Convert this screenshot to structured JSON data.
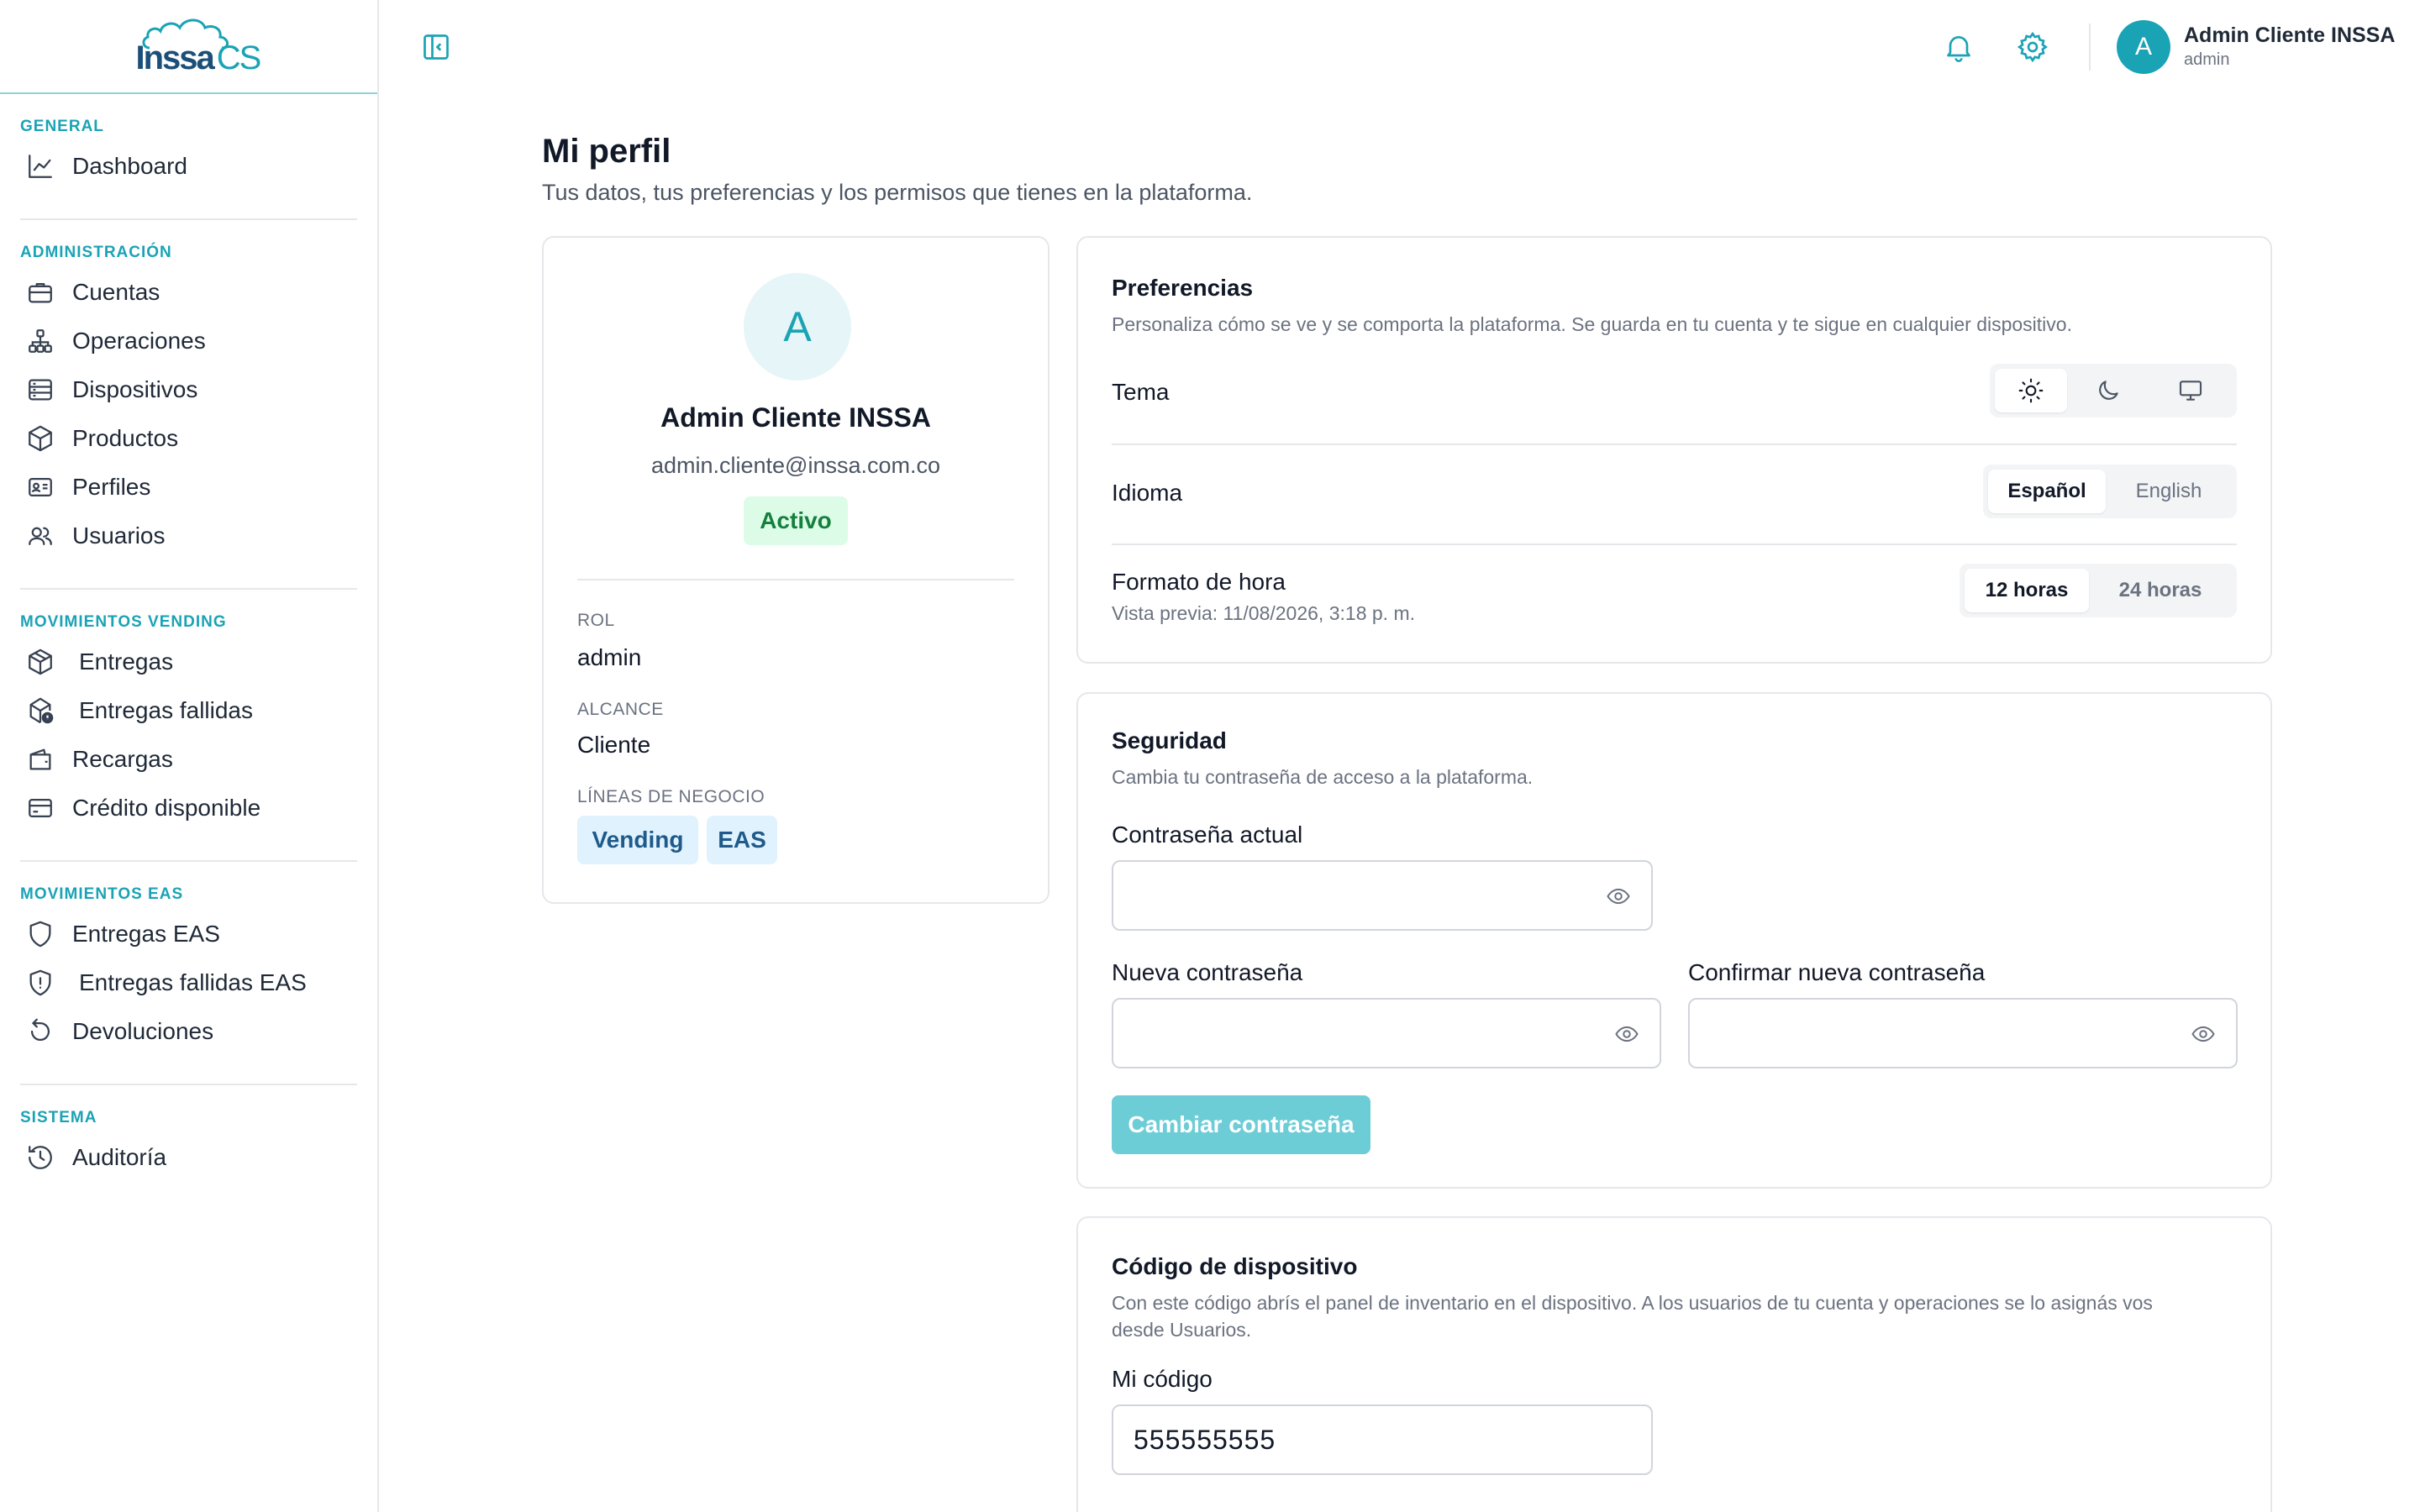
{
  "app": {
    "logo_text": "Inssa",
    "logo_suffix": "CS"
  },
  "sidebar": {
    "sections": [
      {
        "title": "GENERAL",
        "items": [
          {
            "label": "Dashboard",
            "icon": "chart-line-icon"
          }
        ]
      },
      {
        "title": "ADMINISTRACIÓN",
        "items": [
          {
            "label": "Cuentas",
            "icon": "briefcase-icon"
          },
          {
            "label": "Operaciones",
            "icon": "network-icon"
          },
          {
            "label": "Dispositivos",
            "icon": "server-icon"
          },
          {
            "label": "Productos",
            "icon": "box-icon"
          },
          {
            "label": "Perfiles",
            "icon": "id-card-icon"
          },
          {
            "label": "Usuarios",
            "icon": "users-icon"
          }
        ]
      },
      {
        "title": "MOVIMIENTOS VENDING",
        "items": [
          {
            "label": "Entregas",
            "icon": "package-icon"
          },
          {
            "label": "Entregas fallidas",
            "icon": "package-alert-icon"
          },
          {
            "label": "Recargas",
            "icon": "wallet-icon"
          },
          {
            "label": "Crédito disponible",
            "icon": "credit-card-icon"
          }
        ]
      },
      {
        "title": "MOVIMIENTOS EAS",
        "items": [
          {
            "label": "Entregas EAS",
            "icon": "shield-icon"
          },
          {
            "label": "Entregas fallidas EAS",
            "icon": "shield-alert-icon"
          },
          {
            "label": "Devoluciones",
            "icon": "undo-icon"
          }
        ]
      },
      {
        "title": "SISTEMA",
        "items": [
          {
            "label": "Auditoría",
            "icon": "history-icon"
          }
        ]
      }
    ]
  },
  "header": {
    "user_initial": "A",
    "user_name": "Admin Cliente INSSA",
    "user_role": "admin"
  },
  "page": {
    "title": "Mi perfil",
    "subtitle": "Tus datos, tus preferencias y los permisos que tienes en la plataforma."
  },
  "profile": {
    "initial": "A",
    "name": "Admin Cliente INSSA",
    "email": "admin.cliente@inssa.com.co",
    "status": "Activo",
    "role_label": "ROL",
    "role_value": "admin",
    "scope_label": "ALCANCE",
    "scope_value": "Cliente",
    "lines_label": "LÍNEAS DE NEGOCIO",
    "lines": [
      "Vending",
      "EAS"
    ]
  },
  "preferences": {
    "title": "Preferencias",
    "subtitle": "Personaliza cómo se ve y se comporta la plataforma. Se guarda en tu cuenta y te sigue en cualquier dispositivo.",
    "theme_label": "Tema",
    "theme_options": [
      "sun-icon",
      "moon-icon",
      "monitor-icon"
    ],
    "language_label": "Idioma",
    "language_options": [
      "Español",
      "English"
    ],
    "language_selected": "Español",
    "time_label": "Formato de hora",
    "time_preview": "Vista previa: 11/08/2026, 3:18 p. m.",
    "time_options": [
      "12 horas",
      "24 horas"
    ],
    "time_selected": "12 horas"
  },
  "security": {
    "title": "Seguridad",
    "subtitle": "Cambia tu contraseña de acceso a la plataforma.",
    "current_label": "Contraseña actual",
    "new_label": "Nueva contraseña",
    "confirm_label": "Confirmar nueva contraseña",
    "submit_label": "Cambiar contraseña"
  },
  "device": {
    "title": "Código de dispositivo",
    "subtitle_line1": "Con este código abrís el panel de inventario en el dispositivo. A los usuarios de tu cuenta y operaciones se lo asignás vos",
    "subtitle_line2": "desde Usuarios.",
    "code_label": "Mi código",
    "code_value": "555555555"
  },
  "colors": {
    "accent": "#1aa3b5",
    "brand_dark": "#1b4f7a",
    "success_bg": "#dcfce7",
    "success_text": "#15803d",
    "chip_bg": "#e0f2fe",
    "button_disabled": "#6dcdd6"
  }
}
